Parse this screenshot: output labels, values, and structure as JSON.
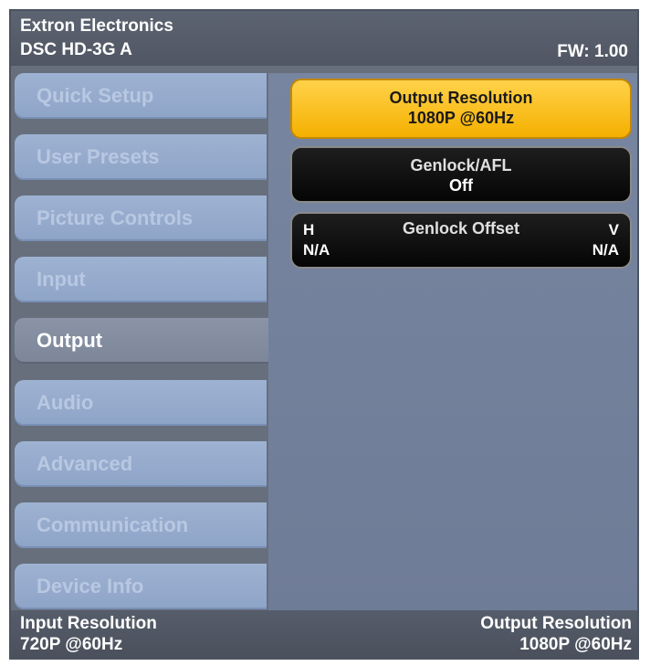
{
  "header": {
    "brand": "Extron Electronics",
    "model": "DSC HD-3G A",
    "firmware": "FW: 1.00"
  },
  "sidebar": {
    "items": [
      {
        "label": "Quick Setup"
      },
      {
        "label": "User Presets"
      },
      {
        "label": "Picture Controls"
      },
      {
        "label": "Input"
      },
      {
        "label": "Output"
      },
      {
        "label": "Audio"
      },
      {
        "label": "Advanced"
      },
      {
        "label": "Communication"
      },
      {
        "label": "Device Info"
      }
    ],
    "active": "Output"
  },
  "content": {
    "output_resolution": {
      "label": "Output Resolution",
      "value": "1080P @60Hz"
    },
    "genlock": {
      "label": "Genlock/AFL",
      "value": "Off"
    },
    "genlock_offset": {
      "label": "Genlock Offset",
      "h_label": "H",
      "v_label": "V",
      "h_value": "N/A",
      "v_value": "N/A"
    }
  },
  "footer": {
    "input_label": "Input Resolution",
    "input_value": "720P @60Hz",
    "output_label": "Output Resolution",
    "output_value": "1080P @60Hz"
  },
  "colors": {
    "selected_button": "#f5b000",
    "panel_background": "#6f7c97",
    "menu_item": "#9eb2d2"
  }
}
